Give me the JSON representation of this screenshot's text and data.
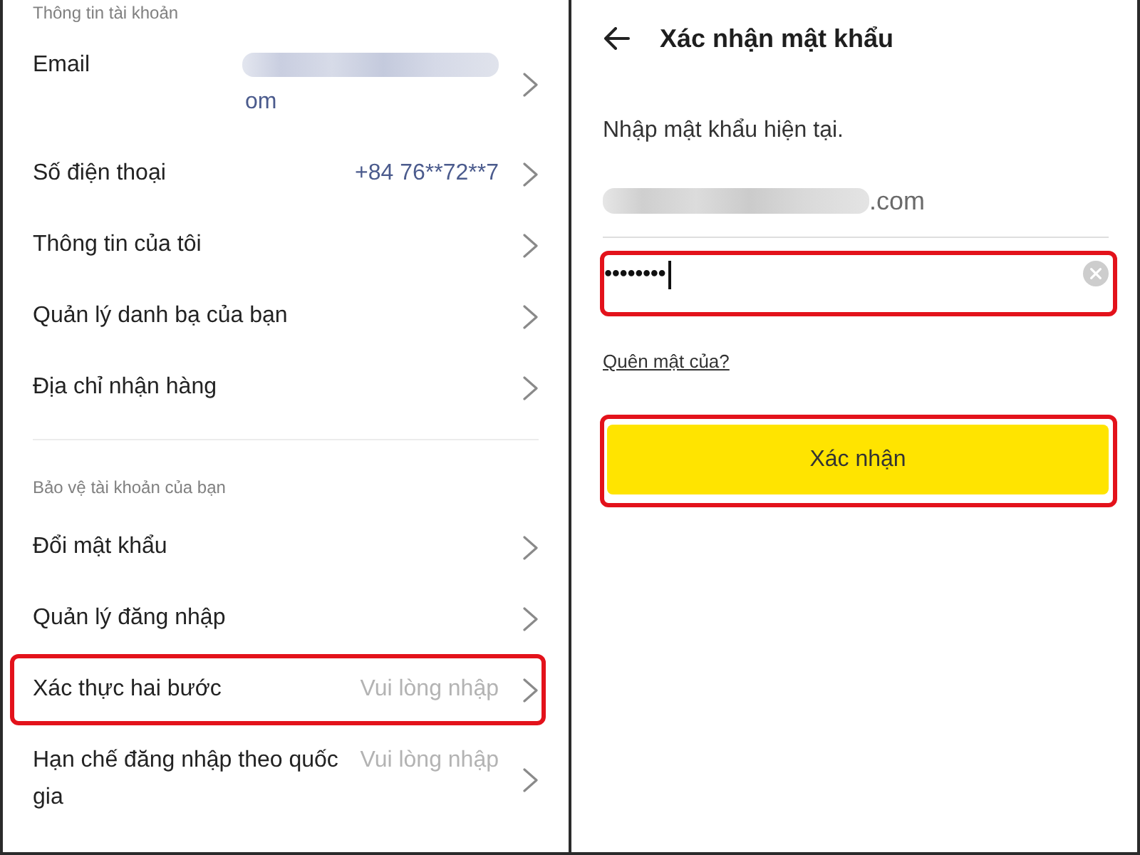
{
  "account_screen": {
    "sections": [
      {
        "title": "Thông tin tài khoản",
        "items": [
          {
            "label": "Email",
            "value": "om",
            "redacted": true,
            "highlighted": false
          },
          {
            "label": "Số điện thoại",
            "value": "+84 76**72**7",
            "redacted": false,
            "highlighted": false
          },
          {
            "label": "Thông tin của tôi",
            "redacted": false,
            "highlighted": false
          },
          {
            "label": "Quản lý danh bạ của bạn",
            "redacted": false,
            "highlighted": false
          },
          {
            "label": "Địa chỉ nhận hàng",
            "redacted": false,
            "highlighted": false
          }
        ]
      },
      {
        "title": "Bảo vệ tài khoản của bạn",
        "items": [
          {
            "label": "Đổi mật khẩu",
            "redacted": false,
            "highlighted": false
          },
          {
            "label": "Quản lý đăng nhập",
            "redacted": false,
            "highlighted": false
          },
          {
            "label": "Xác thực hai bước",
            "placeholder": "Vui lòng nhập",
            "redacted": false,
            "highlighted": true
          },
          {
            "label": "Hạn chế đăng nhập theo quốc gia",
            "placeholder": "Vui lòng nhập",
            "redacted": false,
            "highlighted": false
          }
        ]
      }
    ]
  },
  "confirm_screen": {
    "title": "Xác nhận mật khẩu",
    "instruction": "Nhập mật khẩu hiện tại.",
    "account": {
      "value": ".com",
      "redacted": true
    },
    "password": {
      "value": "••••••••",
      "focused": true,
      "highlighted": true
    },
    "forgot_link": "Quên mật của?",
    "confirm_button": {
      "label": "Xác nhận",
      "highlighted": true
    }
  }
}
